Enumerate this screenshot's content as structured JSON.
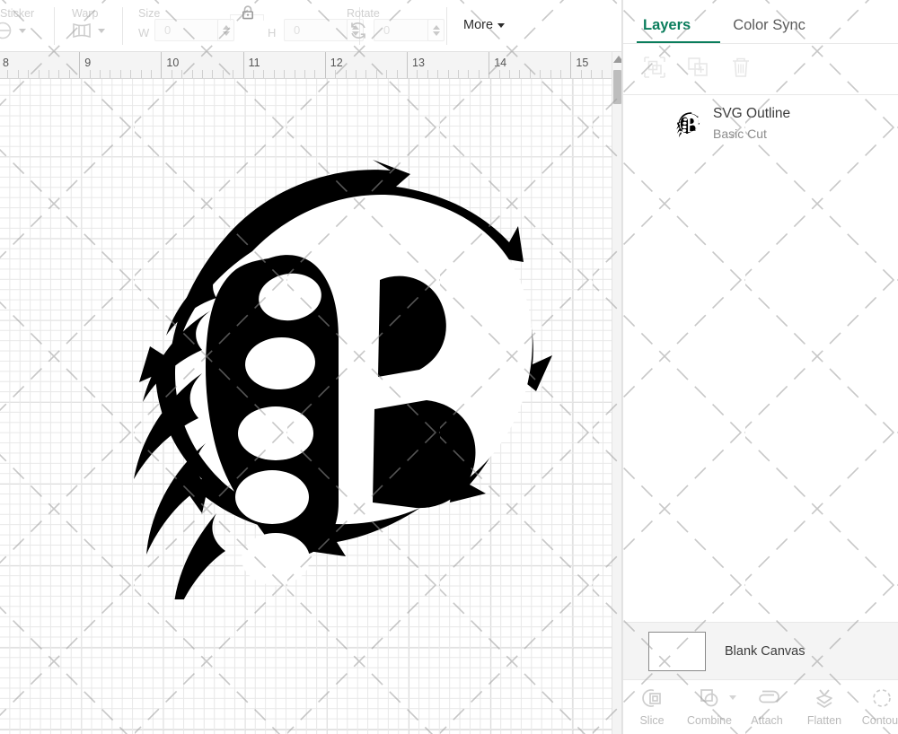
{
  "toolbar": {
    "groups": [
      {
        "label": "Sticker",
        "icon": "sticker-icon"
      },
      {
        "label": "Warp",
        "icon": "warp-icon"
      },
      {
        "label": "Size",
        "icon": "size-icon"
      },
      {
        "label": "Rotate",
        "icon": "rotate-icon"
      }
    ],
    "size": {
      "label": "Size",
      "width_label": "W",
      "width_value": "0",
      "height_label": "H",
      "height_value": "0",
      "lock_icon": "lock-closed-icon",
      "lock_state": "locked"
    },
    "rotate": {
      "label": "Rotate",
      "value": "0",
      "icon": "rotate-icon"
    },
    "more": {
      "label": "More",
      "caret": "chevron-down-icon"
    }
  },
  "ruler": {
    "unit": "inches",
    "ticks": [
      "8",
      "9",
      "10",
      "11",
      "12",
      "13",
      "14",
      "15"
    ],
    "minor_divisions": 8
  },
  "canvas": {
    "grid": "on",
    "artwork_name": "SVG Outline",
    "artwork_color": "#000000",
    "watermark": "diagonal-dashed-crosshatch"
  },
  "scrollbar": {
    "orientation": "vertical",
    "up_arrow": "triangle-up-icon",
    "thumb_position": "top"
  },
  "panel": {
    "tabs": [
      {
        "id": "layers",
        "label": "Layers",
        "active": true
      },
      {
        "id": "color-sync",
        "label": "Color Sync",
        "active": false
      }
    ],
    "accent_color": "#0a7d5c",
    "inactive_tab_color": "#5a5a5a",
    "actions": [
      {
        "name": "group-objects-button",
        "icon": "group-icon",
        "enabled": false
      },
      {
        "name": "duplicate-layer-button",
        "icon": "duplicate-plus-icon",
        "enabled": false
      },
      {
        "name": "delete-layer-button",
        "icon": "trash-icon",
        "enabled": false
      }
    ],
    "layers": [
      {
        "title": "SVG Outline",
        "subtitle": "Basic Cut",
        "thumbnail": "bear-claw-b-logo-icon"
      }
    ],
    "canvas_row": {
      "label": "Blank Canvas",
      "swatch_color": "#ffffff"
    },
    "bottom_tools": [
      {
        "label": "Slice",
        "icon": "slice-icon",
        "has_caret": false,
        "enabled": false
      },
      {
        "label": "Combine",
        "icon": "combine-icon",
        "has_caret": true,
        "enabled": false
      },
      {
        "label": "Attach",
        "icon": "attach-icon",
        "has_caret": false,
        "enabled": false
      },
      {
        "label": "Flatten",
        "icon": "flatten-icon",
        "has_caret": false,
        "enabled": false
      },
      {
        "label": "Contour",
        "icon": "contour-icon",
        "has_caret": false,
        "enabled": false
      }
    ]
  }
}
